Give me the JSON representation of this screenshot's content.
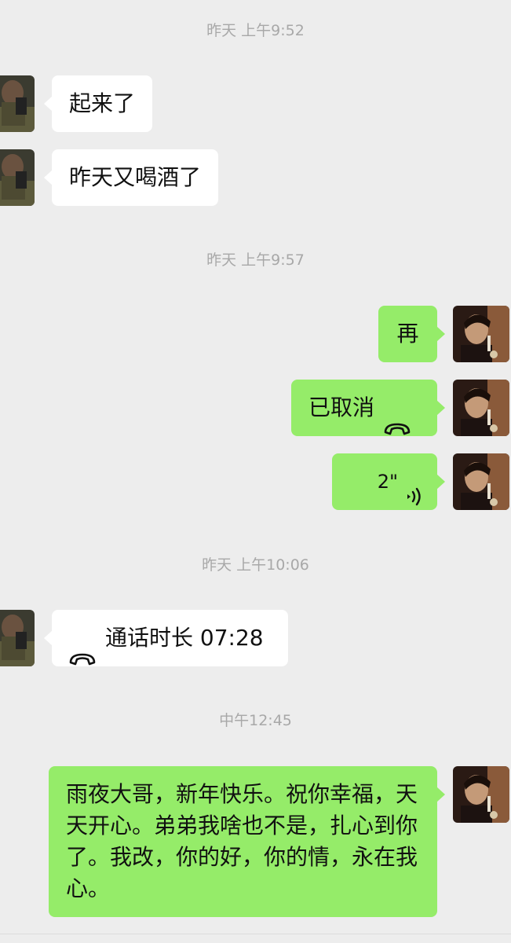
{
  "chat": {
    "timestamps": [
      "昨天 上午9:52",
      "昨天 上午9:57",
      "昨天 上午10:06",
      "中午12:45"
    ],
    "messages": {
      "m1": "起来了",
      "m2": "昨天又喝酒了",
      "m3": "再",
      "m4": "已取消",
      "m5_duration": "2\"",
      "m6": "通话时长 07:28",
      "m7": "雨夜大哥，新年快乐。祝你幸福，天天开心。弟弟我啥也不是，扎心到你了。我改，你的好，你的情，永在我心。"
    }
  },
  "icons": {
    "call": "phone-handset-icon",
    "voice": "voice-wave-icon"
  },
  "colors": {
    "background": "#ededed",
    "incoming_bubble": "#ffffff",
    "outgoing_bubble": "#95ec69",
    "timestamp_text": "#a8a8a8"
  }
}
